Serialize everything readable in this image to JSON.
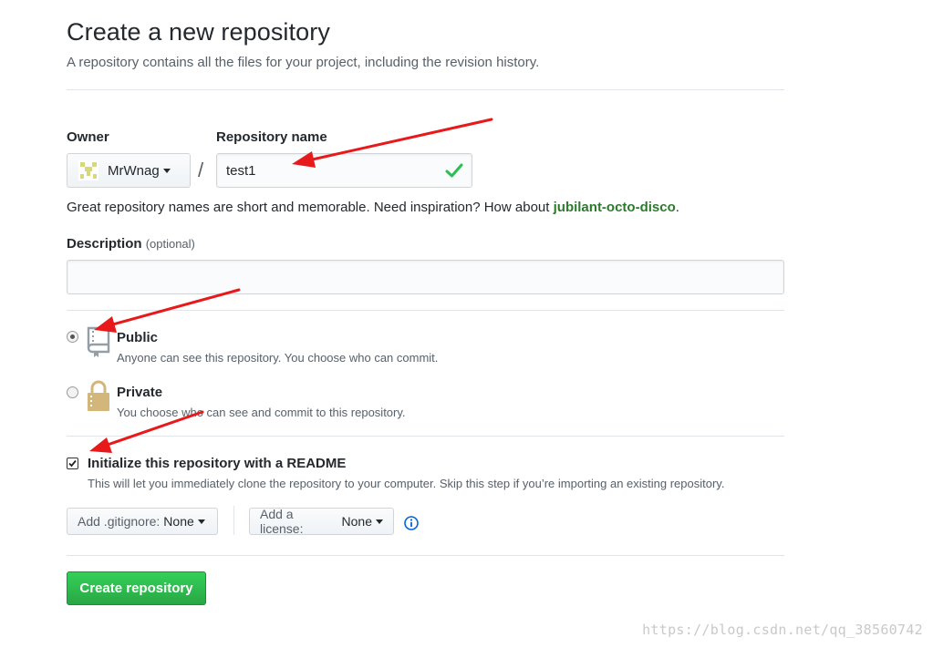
{
  "header": {
    "title": "Create a new repository",
    "subtitle": "A repository contains all the files for your project, including the revision history."
  },
  "owner": {
    "label": "Owner",
    "value": "MrWnag"
  },
  "separator": "/",
  "repository_name": {
    "label": "Repository name",
    "value": "test1",
    "valid": true
  },
  "name_hint": {
    "prefix": "Great repository names are short and memorable. Need inspiration? How about ",
    "suggestion": "jubilant-octo-disco",
    "suffix": "."
  },
  "description": {
    "label": "Description",
    "optional": "(optional)",
    "value": ""
  },
  "visibility": {
    "selected": "public",
    "options": [
      {
        "id": "public",
        "title": "Public",
        "note": "Anyone can see this repository. You choose who can commit.",
        "icon": "repo-icon"
      },
      {
        "id": "private",
        "title": "Private",
        "note": "You choose who can see and commit to this repository.",
        "icon": "lock-icon"
      }
    ]
  },
  "readme": {
    "checked": true,
    "label": "Initialize this repository with a README",
    "note": "This will let you immediately clone the repository to your computer. Skip this step if you’re importing an existing repository."
  },
  "gitignore": {
    "label": "Add .gitignore:",
    "value": "None"
  },
  "license": {
    "label": "Add a license:",
    "value": "None"
  },
  "submit": {
    "label": "Create repository"
  },
  "watermark": "https://blog.csdn.net/qq_38560742",
  "colors": {
    "primary_button": "#28a745",
    "suggestion_text": "#2c7a2c",
    "annotation_arrows": "#e8191b",
    "check": "#2cbe4e",
    "info": "#0366d6"
  }
}
